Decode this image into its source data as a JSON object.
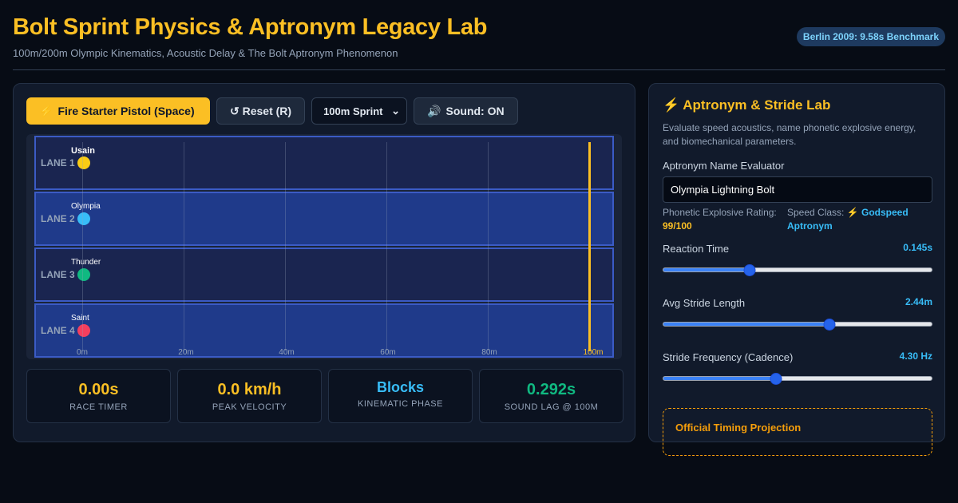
{
  "header": {
    "title": "Bolt Sprint Physics & Aptronym Legacy Lab",
    "subtitle": "100m/200m Olympic Kinematics, Acoustic Delay & The Bolt Aptronym Phenomenon",
    "badge": "Berlin 2009: 9.58s Benchmark"
  },
  "controls": {
    "fire_label": "Fire Starter Pistol (Space)",
    "reset_label": "↺ Reset (R)",
    "event_select": "100m Sprint",
    "sound_label": "Sound: ON"
  },
  "track": {
    "lanes": [
      {
        "label": "LANE 1",
        "runner": "Usain",
        "color": "#facc15"
      },
      {
        "label": "LANE 2",
        "runner": "Olympia",
        "color": "#38bdf8"
      },
      {
        "label": "LANE 3",
        "runner": "Thunder",
        "color": "#10b981"
      },
      {
        "label": "LANE 4",
        "runner": "Saint",
        "color": "#f43f5e"
      }
    ],
    "ticks": [
      "0m",
      "20m",
      "40m",
      "60m",
      "80m",
      "100m"
    ]
  },
  "stats": [
    {
      "value": "0.00s",
      "label": "RACE TIMER",
      "color": "#fbbf24"
    },
    {
      "value": "0.0 km/h",
      "label": "PEAK VELOCITY",
      "color": "#fbbf24"
    },
    {
      "value": "Blocks",
      "label": "KINEMATIC PHASE",
      "color": "#38bdf8"
    },
    {
      "value": "0.292s",
      "label": "SOUND LAG @ 100M",
      "color": "#10b981"
    }
  ],
  "lab": {
    "title": "Aptronym & Stride Lab",
    "description": "Evaluate speed acoustics, name phonetic explosive energy, and biomechanical parameters.",
    "name_label": "Aptronym Name Evaluator",
    "name_value": "Olympia Lightning Bolt",
    "rating_label": "Phonetic Explosive Rating:",
    "rating_value": "99/100",
    "speed_class_label": "Speed Class:",
    "speed_class_value": "⚡ Godspeed Aptronym",
    "sliders": [
      {
        "label": "Reaction Time",
        "value": "0.145s",
        "level": 0.32
      },
      {
        "label": "Avg Stride Length",
        "value": "2.44m",
        "level": 0.62
      },
      {
        "label": "Stride Frequency (Cadence)",
        "value": "4.30 Hz",
        "level": 0.42
      }
    ],
    "projection_title": "Official Timing Projection"
  }
}
